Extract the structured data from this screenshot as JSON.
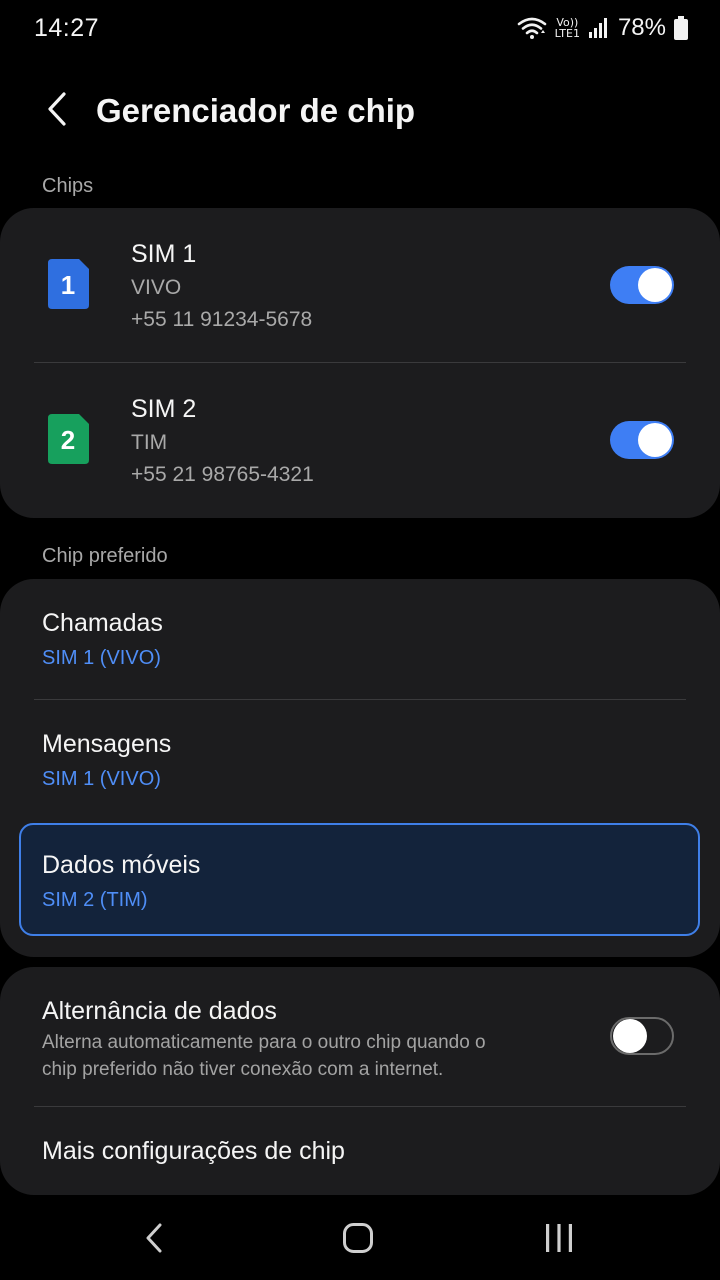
{
  "status_bar": {
    "time": "14:27",
    "battery_percent": "78%",
    "icons": [
      "wifi-icon",
      "volte-lte-icon",
      "signal-icon",
      "battery-icon"
    ],
    "volte_label_top": "Vo))",
    "volte_label_bottom": "LTE1"
  },
  "header": {
    "title": "Gerenciador de chip",
    "back_icon": "back-arrow-icon"
  },
  "chips_section": {
    "label": "Chips",
    "sims": [
      {
        "badge": "1",
        "name": "SIM 1",
        "carrier": "VIVO",
        "number": "+55 11 91234-5678",
        "enabled": true,
        "color": "#2f6fe0"
      },
      {
        "badge": "2",
        "name": "SIM 2",
        "carrier": "TIM",
        "number": "+55 21 98765-4321",
        "enabled": true,
        "color": "#17a05d"
      }
    ]
  },
  "preferred_section": {
    "label": "Chip preferido",
    "items": [
      {
        "title": "Chamadas",
        "value": "SIM 1 (VIVO)"
      },
      {
        "title": "Mensagens",
        "value": "SIM 1 (VIVO)"
      },
      {
        "title": "Dados móveis",
        "value": "SIM 2 (TIM)",
        "selected": true
      }
    ]
  },
  "data_switch": {
    "title": "Alternância de dados",
    "description": "Alterna automaticamente para o outro chip quando o chip preferido não tiver conexão com a internet.",
    "enabled": false
  },
  "more_settings": {
    "label": "Mais configurações de chip"
  },
  "nav_bar": {
    "icons": [
      "back-nav-icon",
      "home-icon",
      "recents-icon"
    ]
  },
  "colors": {
    "accent": "#3e7ef4",
    "background": "#000000",
    "card": "#1c1c1e",
    "selected_bg": "#13233b"
  }
}
